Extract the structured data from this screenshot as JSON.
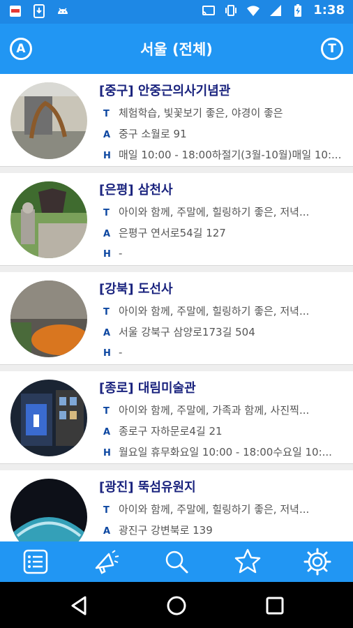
{
  "status_bar": {
    "time": "1:38",
    "left_icons": [
      "app-notification-icon",
      "download-icon",
      "android-icon"
    ],
    "right_icons": [
      "cast-icon",
      "vibrate-icon",
      "wifi-icon",
      "signal-icon",
      "battery-charging-icon"
    ]
  },
  "app_bar": {
    "title": "서울 (전체)",
    "left_button": "A",
    "right_button": "T"
  },
  "labels": {
    "t": "T",
    "a": "A",
    "h": "H"
  },
  "places": [
    {
      "title": "[중구] 안중근의사기념관",
      "tags": "체험학습, 빛꽃보기 좋은, 야경이 좋은",
      "address": "중구 소월로 91",
      "hours": "매일 10:00 - 18:00하절기(3월-10월)매일 10:..."
    },
    {
      "title": "[은평] 삼천사",
      "tags": "아이와 함께, 주말에, 힐링하기 좋은, 저녁...",
      "address": "은평구 연서로54길 127",
      "hours": "-"
    },
    {
      "title": "[강북] 도선사",
      "tags": "아이와 함께, 주말에, 힐링하기 좋은, 저녁...",
      "address": "서울 강북구 삼양로173길 504",
      "hours": "-"
    },
    {
      "title": "[종로] 대림미술관",
      "tags": "아이와 함께, 주말에, 가족과 함께, 사진찍...",
      "address": "종로구 자하문로4길 21",
      "hours": "월요일 휴무화요일 10:00 - 18:00수요일 10:..."
    },
    {
      "title": "[광진] 뚝섬유원지",
      "tags": "아이와 함께, 주말에, 힐링하기 좋은, 저녁...",
      "address": "광진구 강변북로 139",
      "hours": ""
    }
  ],
  "bottom_tabs": [
    "list-icon",
    "megaphone-icon",
    "search-icon",
    "star-icon",
    "settings-icon"
  ],
  "colors": {
    "primary": "#2196f3",
    "status": "#1e88e5",
    "title": "#1a237e"
  }
}
